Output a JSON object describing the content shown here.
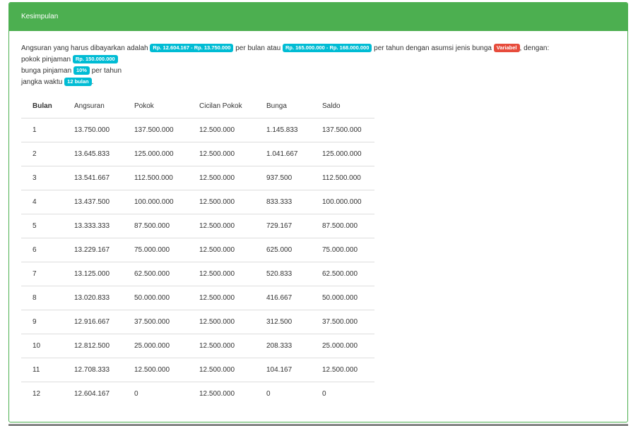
{
  "panel": {
    "title": "Kesimpulan"
  },
  "summary": {
    "text1": "Angsuran yang harus dibayarkan adalah",
    "badge_monthly": "Rp. 12.604.167 - Rp. 13.750.000",
    "text2": "per bulan atau",
    "badge_yearly": "Rp. 165.000.000 - Rp. 168.000.000",
    "text3": "per tahun dengan asumsi jenis bunga",
    "badge_type": "Variabel",
    "text4": ", dengan:",
    "pokok_label": "pokok pinjaman",
    "pokok_value": "Rp. 150.000.000",
    "bunga_label": "bunga pinjaman",
    "bunga_value": "10%",
    "bunga_suffix": "per tahun",
    "jangka_label": "jangka waktu",
    "jangka_value": "12 bulan",
    "jangka_suffix": "."
  },
  "table": {
    "headers": [
      "Bulan",
      "Angsuran",
      "Pokok",
      "Cicilan Pokok",
      "Bunga",
      "Saldo"
    ],
    "rows": [
      [
        "1",
        "13.750.000",
        "137.500.000",
        "12.500.000",
        "1.145.833",
        "137.500.000"
      ],
      [
        "2",
        "13.645.833",
        "125.000.000",
        "12.500.000",
        "1.041.667",
        "125.000.000"
      ],
      [
        "3",
        "13.541.667",
        "112.500.000",
        "12.500.000",
        "937.500",
        "112.500.000"
      ],
      [
        "4",
        "13.437.500",
        "100.000.000",
        "12.500.000",
        "833.333",
        "100.000.000"
      ],
      [
        "5",
        "13.333.333",
        "87.500.000",
        "12.500.000",
        "729.167",
        "87.500.000"
      ],
      [
        "6",
        "13.229.167",
        "75.000.000",
        "12.500.000",
        "625.000",
        "75.000.000"
      ],
      [
        "7",
        "13.125.000",
        "62.500.000",
        "12.500.000",
        "520.833",
        "62.500.000"
      ],
      [
        "8",
        "13.020.833",
        "50.000.000",
        "12.500.000",
        "416.667",
        "50.000.000"
      ],
      [
        "9",
        "12.916.667",
        "37.500.000",
        "12.500.000",
        "312.500",
        "37.500.000"
      ],
      [
        "10",
        "12.812.500",
        "25.000.000",
        "12.500.000",
        "208.333",
        "25.000.000"
      ],
      [
        "11",
        "12.708.333",
        "12.500.000",
        "12.500.000",
        "104.167",
        "12.500.000"
      ],
      [
        "12",
        "12.604.167",
        "0",
        "12.500.000",
        "0",
        "0"
      ]
    ]
  },
  "colors": {
    "header": "#4caf50",
    "badge_info": "#00bcd4",
    "badge_danger": "#e74c3c"
  }
}
